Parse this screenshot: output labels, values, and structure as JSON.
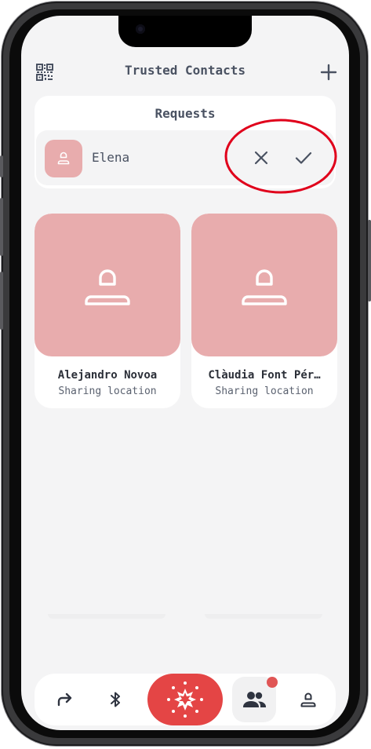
{
  "header": {
    "title": "Trusted Contacts",
    "left_icon": "qr-code-icon",
    "right_icon": "plus-icon"
  },
  "requests": {
    "title": "Requests",
    "items": [
      {
        "name": "Elena",
        "avatar_icon": "person-icon",
        "reject_icon": "close-icon",
        "accept_icon": "check-icon"
      }
    ]
  },
  "contacts": [
    {
      "name": "Alejandro Novoa",
      "status": "Sharing location",
      "avatar_icon": "person-icon"
    },
    {
      "name": "Clàudia Font Pér…",
      "status": "Sharing location",
      "avatar_icon": "person-icon"
    }
  ],
  "bottom_nav": {
    "items": [
      {
        "icon": "share-arrow-icon"
      },
      {
        "icon": "bluetooth-icon"
      },
      {
        "icon": "sos-alert-icon"
      },
      {
        "icon": "contacts-icon",
        "active": true,
        "has_badge": true
      },
      {
        "icon": "profile-icon"
      }
    ]
  },
  "colors": {
    "accent_red": "#e44545",
    "avatar_pink": "#e8acad",
    "text_primary": "#4a5262",
    "screen_bg": "#f4f4f5",
    "annotation_red": "#e0001b"
  }
}
